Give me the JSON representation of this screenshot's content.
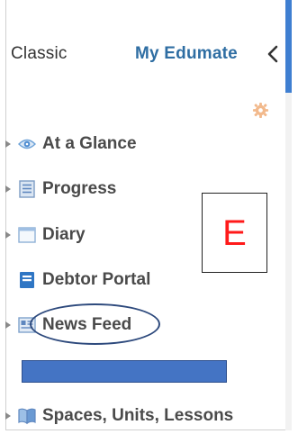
{
  "header": {
    "tab_classic": "Classic",
    "tab_my_edumate": "My Edumate",
    "collapse_icon": "chevron-left-icon"
  },
  "settings_icon": "gear-icon",
  "nav": {
    "items": [
      {
        "label": "At a Glance",
        "icon": "eye-icon",
        "has_caret": true
      },
      {
        "label": "Progress",
        "icon": "document-icon",
        "has_caret": true
      },
      {
        "label": "Diary",
        "icon": "calendar-icon",
        "has_caret": true
      },
      {
        "label": "Debtor Portal",
        "icon": "card-icon",
        "has_caret": false
      },
      {
        "label": "News Feed",
        "icon": "newspaper-icon",
        "has_caret": true
      },
      {
        "label": "Spaces, Units, Lessons",
        "icon": "book-icon",
        "has_caret": true
      }
    ]
  },
  "annotation": {
    "letter": "E",
    "letter_color": "#ff1a1a",
    "oval_color": "#2e4a7d",
    "bar_color": "#4474c4"
  },
  "colors": {
    "accent": "#2f6ea3",
    "scrollbar": "#3f7fd1"
  }
}
